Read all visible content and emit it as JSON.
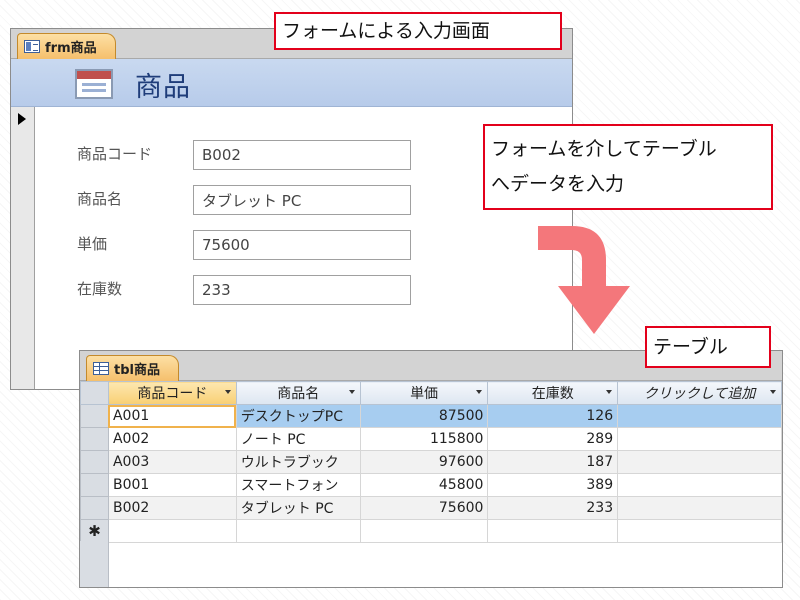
{
  "form": {
    "tab_label": "frm商品",
    "title": "商品",
    "fields": [
      {
        "label": "商品コード",
        "value": "B002"
      },
      {
        "label": "商品名",
        "value": "タブレット PC"
      },
      {
        "label": "単価",
        "value": "75600"
      },
      {
        "label": "在庫数",
        "value": "233"
      }
    ]
  },
  "callouts": {
    "form": "フォームによる入力画面",
    "flow_line1": "フォームを介してテーブル",
    "flow_line2": "へデータを入力",
    "table": "テーブル"
  },
  "table": {
    "tab_label": "tbl商品",
    "columns": [
      "商品コード",
      "商品名",
      "単価",
      "在庫数",
      "クリックして追加"
    ],
    "rows": [
      [
        "A001",
        "デスクトップPC",
        "87500",
        "126"
      ],
      [
        "A002",
        "ノート PC",
        "115800",
        "289"
      ],
      [
        "A003",
        "ウルトラブック",
        "97600",
        "187"
      ],
      [
        "B001",
        "スマートフォン",
        "45800",
        "389"
      ],
      [
        "B002",
        "タブレット PC",
        "75600",
        "233"
      ]
    ],
    "new_row_marker": "✱"
  },
  "colors": {
    "callout_border": "#e3001b",
    "arrow": "#f4777b",
    "header_band": "#c9d9f0",
    "current_row": "#a7cdf0",
    "active_tab": "#f5bf6c"
  },
  "icons": {
    "form_tab": "form-icon",
    "table_tab": "table-icon",
    "record_pointer": "record-pointer-icon",
    "flow": "curved-arrow-icon"
  }
}
